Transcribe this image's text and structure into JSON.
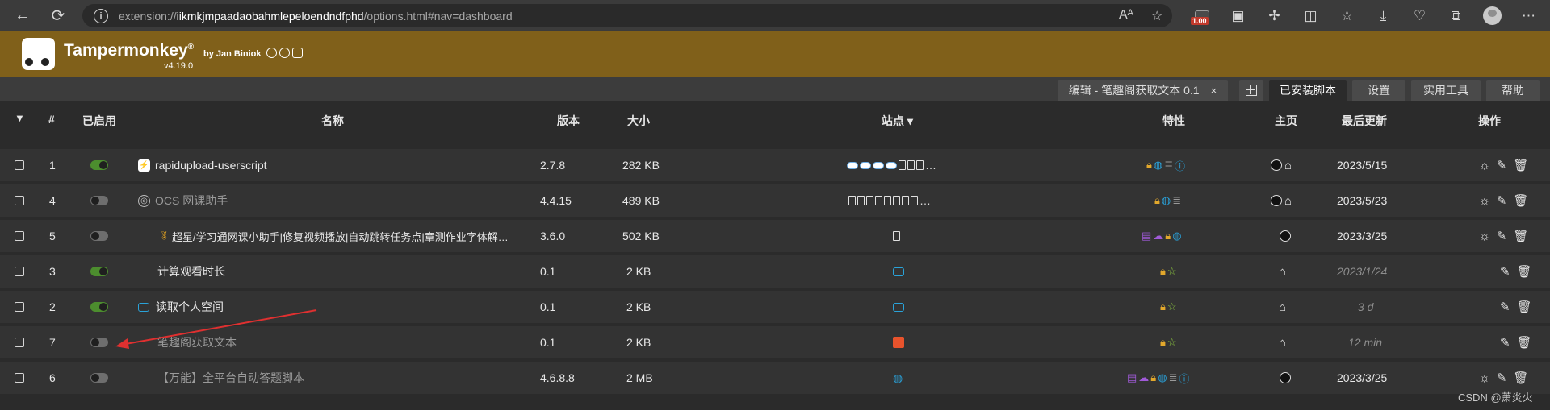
{
  "browser": {
    "url_prefix": "extension://",
    "url_host": "iikmkjmpaadaobahmlepeloendndfphd",
    "url_path": "/options.html#nav=dashboard",
    "ext_badge": "1.00"
  },
  "header": {
    "title": "Tampermonkey",
    "reg": "®",
    "byline": "by Jan Biniok",
    "version": "v4.19.0"
  },
  "tabs": {
    "edit_tab": "编辑 - 笔趣阁获取文本 0.1",
    "close": "×",
    "installed": "已安装脚本",
    "settings": "设置",
    "utilities": "实用工具",
    "help": "帮助"
  },
  "table_headers": {
    "num": "#",
    "enabled": "已启用",
    "name": "名称",
    "version": "版本",
    "size": "大小",
    "sites": "站点 ▾",
    "features": "特性",
    "homepage": "主页",
    "last_updated": "最后更新",
    "actions": "操作"
  },
  "rows": [
    {
      "num": "1",
      "enabled": true,
      "name": "rapidupload-userscript",
      "version": "2.7.8",
      "size": "282 KB",
      "updated": "2023/5/15"
    },
    {
      "num": "4",
      "enabled": false,
      "name": "OCS 网课助手",
      "version": "4.4.15",
      "size": "489 KB",
      "updated": "2023/5/23"
    },
    {
      "num": "5",
      "enabled": false,
      "name": "超星/学习通网课小助手|修复视频播放|自动跳转任务点|章测作业字体解…",
      "version": "3.6.0",
      "size": "502 KB",
      "updated": "2023/3/25"
    },
    {
      "num": "3",
      "enabled": true,
      "name": "计算观看时长",
      "version": "0.1",
      "size": "2 KB",
      "updated": "2023/1/24"
    },
    {
      "num": "2",
      "enabled": true,
      "name": "读取个人空间",
      "version": "0.1",
      "size": "2 KB",
      "updated": "3 d"
    },
    {
      "num": "7",
      "enabled": false,
      "name": "笔趣阁获取文本",
      "version": "0.1",
      "size": "2 KB",
      "updated": "12 min"
    },
    {
      "num": "6",
      "enabled": false,
      "name": "【万能】全平台自动答题脚本",
      "version": "4.6.8.8",
      "size": "2 MB",
      "updated": "2023/3/25"
    }
  ],
  "watermark": "CSDN @萧炎火",
  "colors": {
    "header_bg": "#80601a",
    "toggle_on": "#4c8d2e",
    "accent_blue": "#2a9fd6",
    "lock_yellow": "#e2a82c",
    "star_green": "#8cc63f"
  }
}
